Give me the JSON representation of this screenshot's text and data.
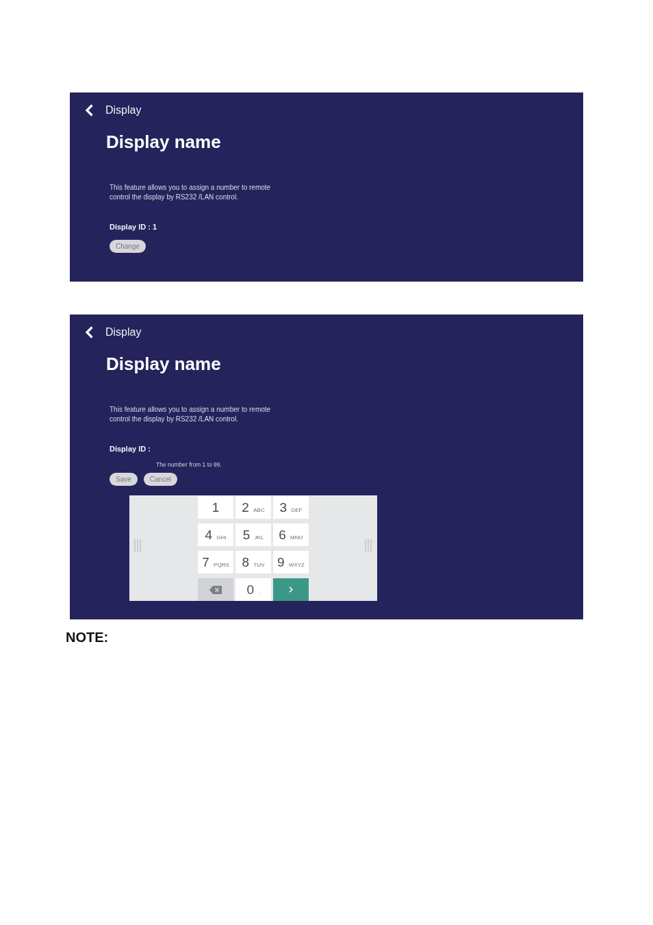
{
  "screens": [
    {
      "back_label": "Display",
      "title": "Display name",
      "description": "This feature allows you to assign a number to remote control the display by RS232 /LAN control.",
      "id_label": "Display ID : 1",
      "buttons": [
        {
          "label": "Change"
        }
      ]
    },
    {
      "back_label": "Display",
      "title": "Display name",
      "description": "This feature allows you to assign a number to remote control the display by RS232 /LAN control.",
      "id_label": "Display ID :",
      "id_field": {
        "placeholder": "The number from 1 to 99."
      },
      "buttons": [
        {
          "label": "Save"
        },
        {
          "label": "Cancel"
        }
      ],
      "keypad": {
        "keys": [
          {
            "kind": "digit",
            "digit": "1"
          },
          {
            "kind": "digit",
            "digit": "2",
            "letters": "ABC"
          },
          {
            "kind": "digit",
            "digit": "3",
            "letters": "DEF"
          },
          {
            "kind": "digit",
            "digit": "4",
            "letters": "GHI"
          },
          {
            "kind": "digit",
            "digit": "5",
            "letters": "JKL"
          },
          {
            "kind": "digit",
            "digit": "6",
            "letters": "MNO"
          },
          {
            "kind": "digit",
            "digit": "7",
            "letters": "PQRS"
          },
          {
            "kind": "digit",
            "digit": "8",
            "letters": "TUV"
          },
          {
            "kind": "digit",
            "digit": "9",
            "letters": "WXYZ"
          },
          {
            "kind": "backspace"
          },
          {
            "kind": "digit",
            "digit": "0",
            "letters": "."
          },
          {
            "kind": "enter"
          }
        ]
      }
    }
  ],
  "note": "NOTE:"
}
